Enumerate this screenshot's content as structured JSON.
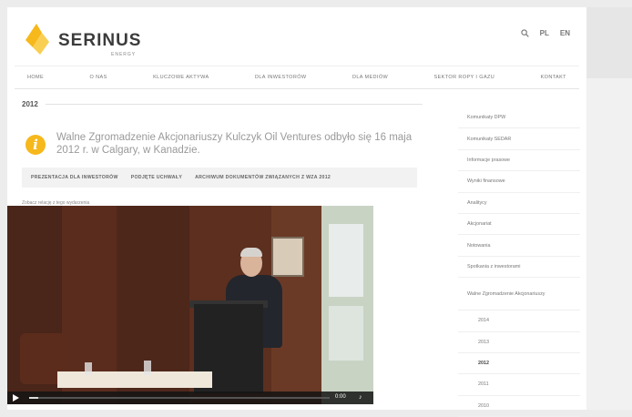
{
  "header": {
    "logo_text": "SERINUS",
    "logo_sub": "ENERGY",
    "utils": {
      "search_icon": "search-icon",
      "lang_pl": "PL",
      "lang_en": "EN"
    }
  },
  "nav": {
    "items": [
      "HOME",
      "O NAS",
      "KLUCZOWE AKTYWA",
      "DLA INWESTORÓW",
      "DLA MEDIÓW",
      "SEKTOR ROPY I GAZU",
      "KONTAKT"
    ]
  },
  "main": {
    "year": "2012",
    "notice_text": "Walne Zgromadzenie Akcjonariuszy Kulczyk Oil Ventures odbyło się 16 maja 2012 r. w Calgary, w Kanadzie.",
    "tabs": [
      "PREZENTACJA DLA INWESTORÓW",
      "PODJĘTE UCHWAŁY",
      "ARCHIWUM DOKUMENTÓW ZWIĄZANYCH Z WZA 2012"
    ],
    "caption": "Zobacz relację z tego wydarzenia",
    "video": {
      "time": "0:00",
      "progress": 0.03
    }
  },
  "sidebar": {
    "items": [
      "Komunikaty DPW",
      "Komunikaty SEDAR",
      "Informacje prasowe",
      "Wyniki finansowe",
      "Analitycy",
      "Akcjonariat",
      "Notowania",
      "Spotkania z inwestorami"
    ],
    "wza_label": "Walne Zgromadzenie Akcjonariuszy",
    "years": [
      "2014",
      "2013",
      "2012",
      "2011",
      "2010"
    ],
    "active_year": "2012"
  },
  "colors": {
    "accent": "#f6b81b",
    "text": "#555555"
  }
}
